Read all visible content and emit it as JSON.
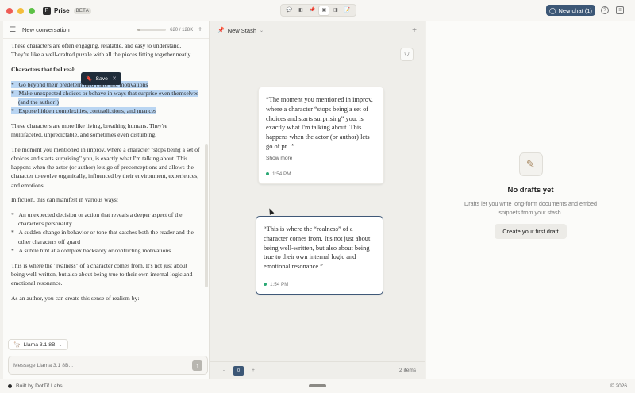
{
  "titlebar": {
    "app_name": "Prise",
    "badge": "BETA",
    "new_chat_label": "New chat (1)",
    "layout_icons": [
      "chat-icon",
      "split-icon",
      "pin-icon",
      "panel-icon",
      "columns-icon",
      "draft-icon"
    ]
  },
  "left": {
    "conversation_title": "New conversation",
    "token_count": "620 / 128K",
    "token_fraction": 0.005,
    "save_popup_label": "Save",
    "paragraphs": {
      "p1": "These characters are often engaging, relatable, and easy to understand. They're like a well-crafted puzzle with all the pieces fitting together neatly.",
      "p2_heading": "Characters that feel real:",
      "b1": "Go beyond their predetermined traits and motivations",
      "b2": "Make unexpected choices or behave in ways that surprise even themselves (and the author!)",
      "b3": "Expose hidden complexities, contradictions, and nuances",
      "p3": "These characters are more like living, breathing humans. They're multifaceted, unpredictable, and sometimes even disturbing.",
      "p4": "The moment you mentioned in improv, where a character \"stops being a set of choices and starts surprising\" you, is exactly what I'm talking about. This happens when the actor (or author) lets go of preconceptions and allows the character to evolve organically, influenced by their environment, experiences, and emotions.",
      "p5": "In fiction, this can manifest in various ways:",
      "c1": "An unexpected decision or action that reveals a deeper aspect of the character's personality",
      "c2": "A sudden change in behavior or tone that catches both the reader and the other characters off guard",
      "c3": "A subtle hint at a complex backstory or conflicting motivations",
      "p6": "This is where the \"realness\" of a character comes from. It's not just about being well-written, but also about being true to their own internal logic and emotional resonance.",
      "p7": "As an author, you can create this sense of realism by:"
    },
    "model_label": "Llama 3.1 8B",
    "composer_placeholder": "Message Llama 3.1 8B..."
  },
  "middle": {
    "stash_title": "New Stash",
    "cards": [
      {
        "text": "“The moment you mentioned in improv, where a character “stops being a set of choices and starts surprising” you, is exactly what I'm talking about. This happens when the actor (or author) lets go of pr...”",
        "show_more": "Show more",
        "time": "1:54 PM"
      },
      {
        "text": "“This is where the “realness” of a character comes from. It's not just about being well-written, but also about being true to their own internal logic and emotional resonance.”",
        "time": "1:54 PM"
      }
    ],
    "zoom_minus": "-",
    "zoom_value": "0",
    "zoom_plus": "+",
    "item_count": "2 items"
  },
  "right": {
    "empty_title": "No drafts yet",
    "empty_desc": "Drafts let you write long-form documents and embed snippets from your stash.",
    "cta_label": "Create your first draft"
  },
  "status": {
    "built_by": "Built by DotTif Labs",
    "copyright": "© 2026"
  },
  "colors": {
    "accent": "#3c5776",
    "highlight": "#b9d5f2",
    "status_green": "#2aa874"
  }
}
